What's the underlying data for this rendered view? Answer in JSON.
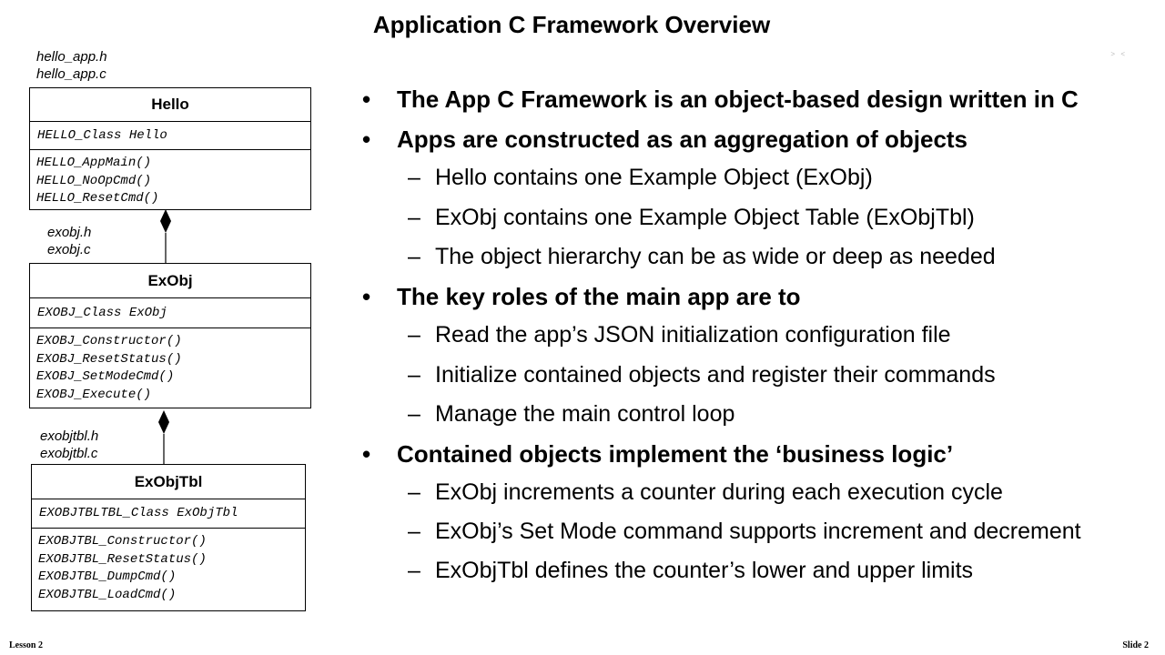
{
  "title": "Application C Framework Overview",
  "corner_mark": "> <",
  "diagram": {
    "hello": {
      "files": [
        "hello_app.h",
        "hello_app.c"
      ],
      "name": "Hello",
      "attr": "HELLO_Class Hello",
      "ops": [
        "HELLO_AppMain()",
        "HELLO_NoOpCmd()",
        "HELLO_ResetCmd()"
      ]
    },
    "exobj": {
      "files": [
        "exobj.h",
        "exobj.c"
      ],
      "name": "ExObj",
      "attr": "EXOBJ_Class ExObj",
      "ops": [
        "EXOBJ_Constructor()",
        "EXOBJ_ResetStatus()",
        "EXOBJ_SetModeCmd()",
        "EXOBJ_Execute()"
      ]
    },
    "exobjtbl": {
      "files": [
        "exobjtbl.h",
        "exobjtbl.c"
      ],
      "name": "ExObjTbl",
      "attr": "EXOBJTBLTBL_Class ExObjTbl",
      "ops": [
        "EXOBJTBL_Constructor()",
        "EXOBJTBL_ResetStatus()",
        "EXOBJTBL_DumpCmd()",
        "EXOBJTBL_LoadCmd()"
      ]
    }
  },
  "bullets": [
    {
      "level": 1,
      "mark": "•",
      "text": "The App C Framework is an object-based design written in C"
    },
    {
      "level": 1,
      "mark": "•",
      "text": "Apps are constructed as an aggregation of objects"
    },
    {
      "level": 2,
      "mark": "–",
      "text": "Hello contains one Example Object (ExObj)"
    },
    {
      "level": 2,
      "mark": "–",
      "text": "ExObj contains one Example Object Table (ExObjTbl)"
    },
    {
      "level": 2,
      "mark": "–",
      "text": "The object hierarchy can be as wide or deep as needed"
    },
    {
      "level": 1,
      "mark": "•",
      "text": "The key roles of the main app are to"
    },
    {
      "level": 2,
      "mark": "–",
      "text": "Read the app’s JSON initialization configuration file"
    },
    {
      "level": 2,
      "mark": "–",
      "text": "Initialize contained objects and register their commands"
    },
    {
      "level": 2,
      "mark": "–",
      "text": "Manage the main control loop"
    },
    {
      "level": 1,
      "mark": "•",
      "text": "Contained objects implement the ‘business logic’"
    },
    {
      "level": 2,
      "mark": "–",
      "text": "ExObj increments a counter during each execution cycle"
    },
    {
      "level": 2,
      "mark": "–",
      "text": "ExObj’s Set Mode command supports increment and decrement"
    },
    {
      "level": 2,
      "mark": "–",
      "text": "ExObjTbl defines the counter’s lower and upper limits"
    }
  ],
  "footer": {
    "left": "Lesson 2",
    "right": "Slide 2"
  }
}
